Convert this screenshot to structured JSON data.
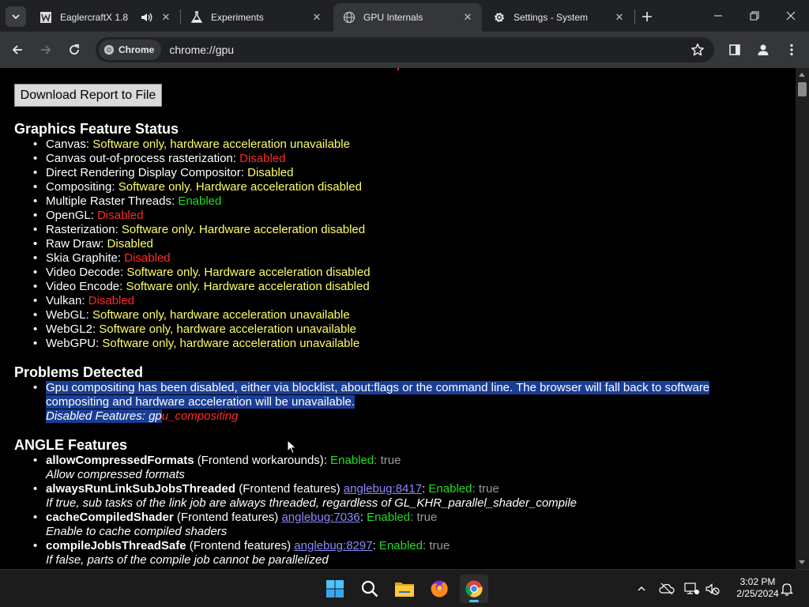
{
  "tabs": [
    {
      "title": "EaglercraftX 1.8",
      "icon": "eaglercraft-icon",
      "audio": true
    },
    {
      "title": "Experiments",
      "icon": "flask-icon"
    },
    {
      "title": "GPU Internals",
      "icon": "globe-icon",
      "active": true
    },
    {
      "title": "Settings - System",
      "icon": "gear-icon"
    }
  ],
  "omnibox": {
    "chip_label": "Chrome",
    "url": "chrome://gpu"
  },
  "page": {
    "download_button": "Download Report to File",
    "graphics_feature_status": {
      "heading": "Graphics Feature Status",
      "items": [
        {
          "name": "Canvas",
          "status": "Software only, hardware acceleration unavailable",
          "color": "yellow"
        },
        {
          "name": "Canvas out-of-process rasterization",
          "status": "Disabled",
          "color": "red"
        },
        {
          "name": "Direct Rendering Display Compositor",
          "status": "Disabled",
          "color": "yellow"
        },
        {
          "name": "Compositing",
          "status": "Software only. Hardware acceleration disabled",
          "color": "yellow"
        },
        {
          "name": "Multiple Raster Threads",
          "status": "Enabled",
          "color": "green"
        },
        {
          "name": "OpenGL",
          "status": "Disabled",
          "color": "red"
        },
        {
          "name": "Rasterization",
          "status": "Software only. Hardware acceleration disabled",
          "color": "yellow"
        },
        {
          "name": "Raw Draw",
          "status": "Disabled",
          "color": "yellow"
        },
        {
          "name": "Skia Graphite",
          "status": "Disabled",
          "color": "red"
        },
        {
          "name": "Video Decode",
          "status": "Software only. Hardware acceleration disabled",
          "color": "yellow"
        },
        {
          "name": "Video Encode",
          "status": "Software only. Hardware acceleration disabled",
          "color": "yellow"
        },
        {
          "name": "Vulkan",
          "status": "Disabled",
          "color": "red"
        },
        {
          "name": "WebGL",
          "status": "Software only, hardware acceleration unavailable",
          "color": "yellow"
        },
        {
          "name": "WebGL2",
          "status": "Software only, hardware acceleration unavailable",
          "color": "yellow"
        },
        {
          "name": "WebGPU",
          "status": "Software only, hardware acceleration unavailable",
          "color": "yellow"
        }
      ]
    },
    "problems_detected": {
      "heading": "Problems Detected",
      "problem_text": "Gpu compositing has been disabled, either via blocklist, about:flags or the command line. The browser will fall back to software compositing and hardware acceleration will be unavailable.",
      "disabled_features_label": "Disabled Features: ",
      "disabled_feature_selected": "gp",
      "disabled_feature_rest": "u_compositing"
    },
    "angle_features": {
      "heading": "ANGLE Features",
      "items": [
        {
          "name": "allowCompressedFormats",
          "category": " (Frontend workarounds)",
          "bug": "",
          "status": "Enabled",
          "value": "true",
          "description": "Allow compressed formats"
        },
        {
          "name": "alwaysRunLinkSubJobsThreaded",
          "category": " (Frontend features) ",
          "bug": "anglebug:8417",
          "status": "Enabled",
          "value": "true",
          "description": "If true, sub tasks of the link job are always threaded, regardless of GL_KHR_parallel_shader_compile"
        },
        {
          "name": "cacheCompiledShader",
          "category": " (Frontend features) ",
          "bug": "anglebug:7036",
          "status": "Enabled",
          "value": "true",
          "description": "Enable to cache compiled shaders"
        },
        {
          "name": "compileJobIsThreadSafe",
          "category": " (Frontend features) ",
          "bug": "anglebug:8297",
          "status": "Enabled",
          "value": "true",
          "description": "If false, parts of the compile job cannot be parallelized"
        }
      ]
    }
  },
  "taskbar": {
    "apps": [
      "windows-start-icon",
      "search-icon",
      "file-explorer-icon",
      "firefox-icon",
      "chrome-icon"
    ],
    "time": "3:02 PM",
    "date": "2/25/2024"
  },
  "colors": {
    "yellow": "#ffff66",
    "red": "#ff2a2a",
    "green": "#22dd22",
    "selection": "#1a3e96"
  }
}
